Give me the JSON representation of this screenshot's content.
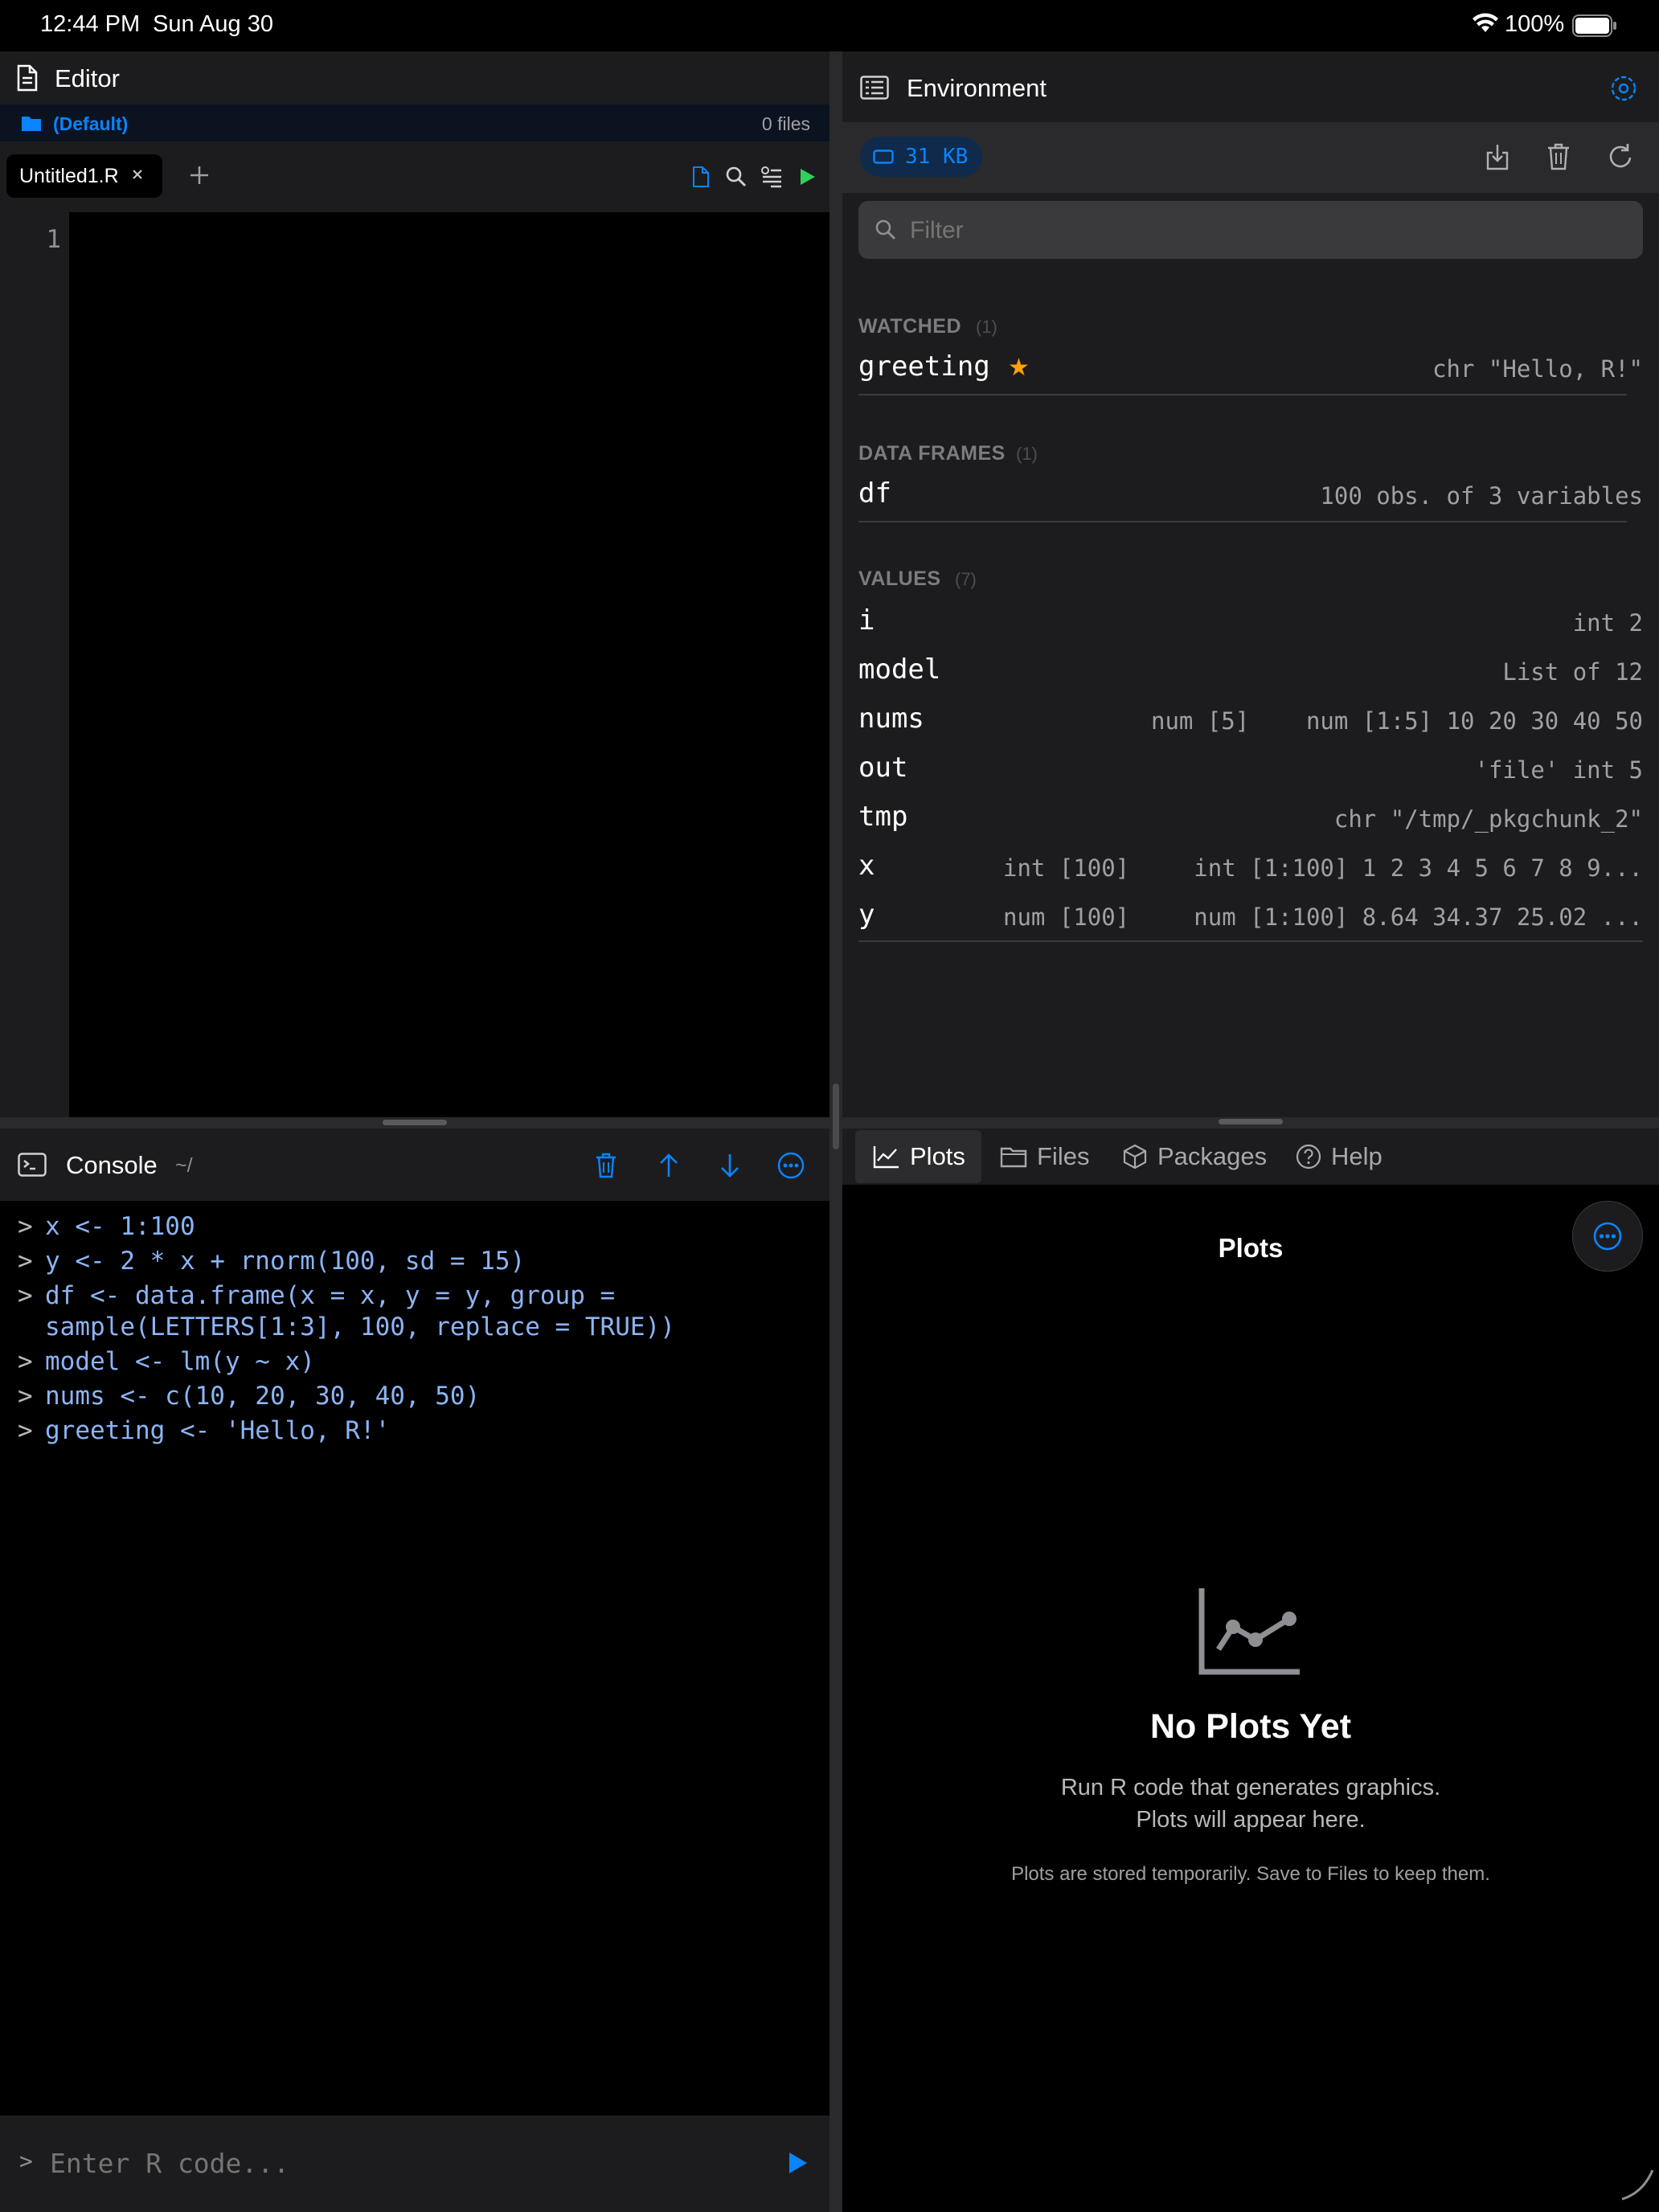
{
  "status_bar": {
    "time": "12:44 PM",
    "date": "Sun Aug 30",
    "battery": "100%"
  },
  "editor": {
    "title": "Editor",
    "project": "(Default)",
    "file_count": "0 files",
    "tab": "Untitled1.R",
    "line_number": "1"
  },
  "console": {
    "title": "Console",
    "path": "~/",
    "prompt": ">",
    "lines": [
      "x <- 1:100",
      "y <- 2 * x + rnorm(100, sd = 15)",
      "df <- data.frame(x = x, y = y, group =",
      "sample(LETTERS[1:3], 100, replace = TRUE))",
      "model <- lm(y ~ x)",
      "nums <- c(10, 20, 30, 40, 50)",
      "greeting <- 'Hello, R!'"
    ],
    "input_placeholder": "Enter R code..."
  },
  "environment": {
    "title": "Environment",
    "memory": "31 KB",
    "filter_placeholder": "Filter",
    "watched": {
      "title": "WATCHED",
      "count": "(1)",
      "items": [
        {
          "name": "greeting",
          "value": "chr \"Hello, R!\""
        }
      ]
    },
    "data_frames": {
      "title": "DATA FRAMES",
      "count": "(1)",
      "items": [
        {
          "name": "df",
          "value": "100 obs. of 3 variables"
        }
      ]
    },
    "values": {
      "title": "VALUES",
      "count": "(7)",
      "items": [
        {
          "name": "i",
          "type": "",
          "value": "int 2"
        },
        {
          "name": "model",
          "type": "",
          "value": "List of 12"
        },
        {
          "name": "nums",
          "type": "num [5]",
          "value": "num [1:5] 10 20 30 40 50"
        },
        {
          "name": "out",
          "type": "",
          "value": "'file' int 5"
        },
        {
          "name": "tmp",
          "type": "",
          "value": "chr \"/tmp/_pkgchunk_2\""
        },
        {
          "name": "x",
          "type": "int [100]",
          "value": "int [1:100] 1 2 3 4 5 6 7 8 9..."
        },
        {
          "name": "y",
          "type": "num [100]",
          "value": "num [1:100] 8.64 34.37 25.02 ..."
        }
      ]
    }
  },
  "bottom_tabs": [
    "Plots",
    "Files",
    "Packages",
    "Help"
  ],
  "plots": {
    "title": "Plots",
    "empty_title": "No Plots Yet",
    "empty_line1": "Run R code that generates graphics.",
    "empty_line2": "Plots will appear here.",
    "note": "Plots are stored temporarily. Save to Files to keep them."
  },
  "colors": {
    "accent": "#0a84ff",
    "run_green": "#30d158",
    "star": "#ff9f0a",
    "code": "#8cb4f5"
  }
}
